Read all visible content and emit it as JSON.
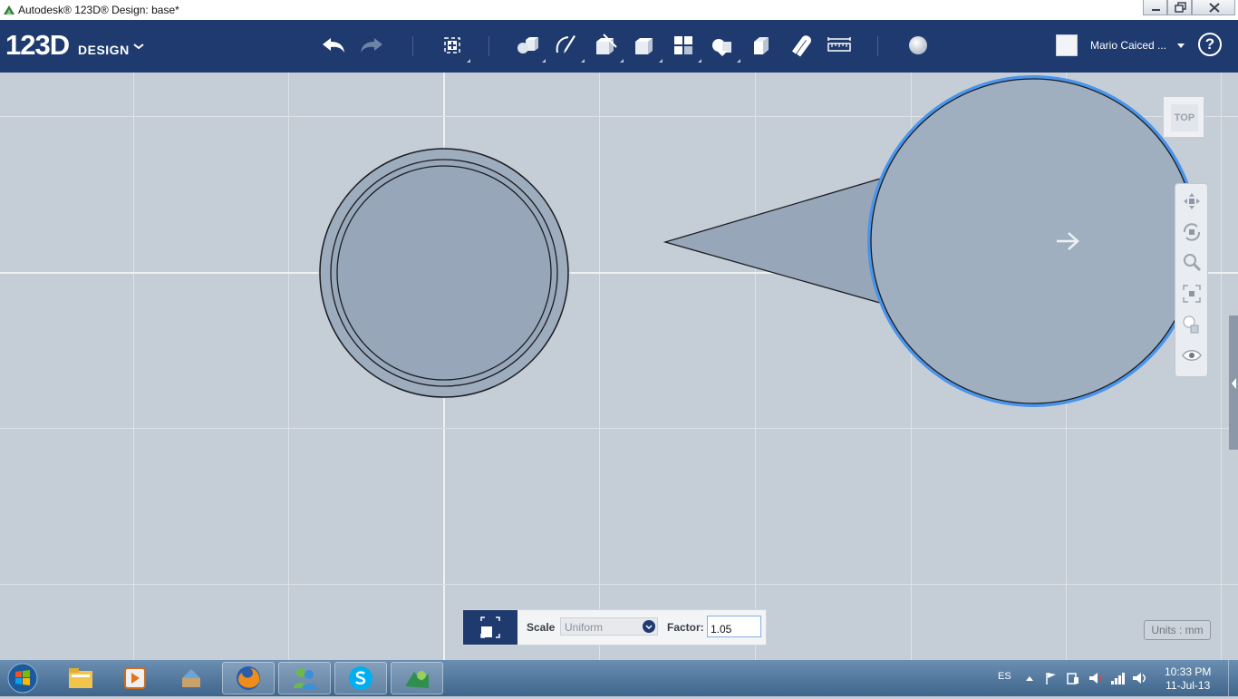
{
  "window": {
    "title": "Autodesk® 123D® Design: base*",
    "controls": [
      "minimize-icon",
      "restore-icon",
      "close-icon"
    ]
  },
  "toolbar": {
    "logo_number": "123D",
    "logo_word": "DESIGN",
    "tools": [
      {
        "name": "undo",
        "icon": "undo-icon"
      },
      {
        "name": "redo",
        "icon": "redo-icon"
      },
      {
        "name": "transform",
        "icon": "transform-icon"
      },
      {
        "name": "primitives",
        "icon": "primitives-icon"
      },
      {
        "name": "sketch",
        "icon": "sketch-icon"
      },
      {
        "name": "construct",
        "icon": "construct-icon"
      },
      {
        "name": "modify",
        "icon": "modify-icon"
      },
      {
        "name": "pattern",
        "icon": "pattern-icon"
      },
      {
        "name": "grouping",
        "icon": "grouping-icon"
      },
      {
        "name": "combine",
        "icon": "combine-icon"
      },
      {
        "name": "snap",
        "icon": "snap-icon"
      },
      {
        "name": "measure",
        "icon": "measure-icon"
      },
      {
        "name": "material",
        "icon": "material-icon"
      }
    ],
    "user_name": "Mario Caiced ...",
    "help_label": "?"
  },
  "viewport": {
    "view_cube_label": "TOP",
    "nav_tools": [
      "pan-icon",
      "orbit-icon",
      "zoom-icon",
      "fit-icon",
      "visual-style-icon",
      "visibility-icon"
    ],
    "units_label": "Units : mm"
  },
  "scale_panel": {
    "scale_label": "Scale",
    "mode_value": "Uniform",
    "factor_label": "Factor:",
    "factor_value": "1.05"
  },
  "taskbar": {
    "apps": [
      "explorer-icon",
      "media-player-icon",
      "game-icon",
      "firefox-icon",
      "messenger-icon",
      "skype-icon",
      "123d-design-icon"
    ],
    "language": "ES",
    "time": "10:33 PM",
    "date": "11-Jul-13"
  },
  "colors": {
    "toolbar_bg": "#1e3a6e",
    "canvas_bg": "#c5cdd6",
    "shape_fill": "#99a9bb",
    "selection": "#4a94ea"
  }
}
